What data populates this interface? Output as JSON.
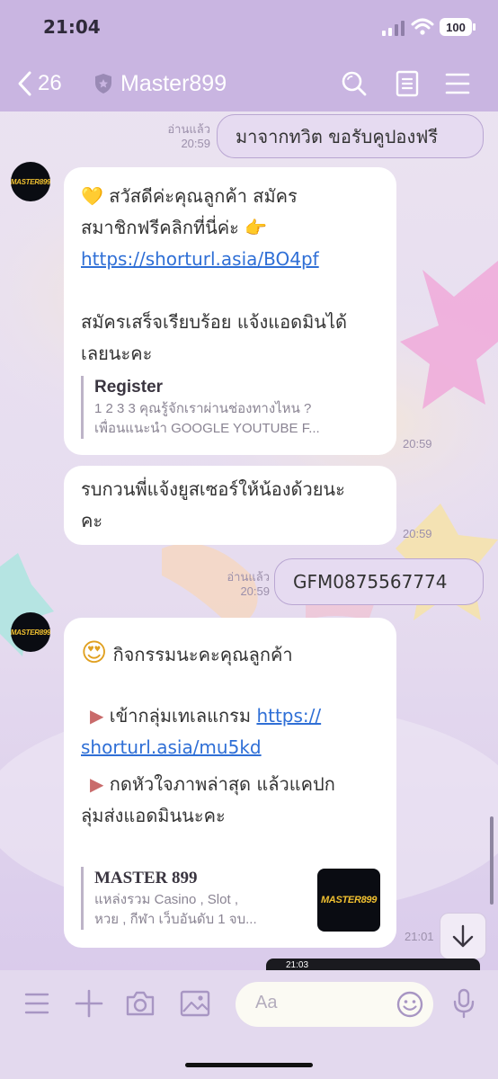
{
  "status": {
    "time": "21:04",
    "battery": "100"
  },
  "header": {
    "back_count": "26",
    "title": "Master899"
  },
  "messages": {
    "m1": {
      "text": "มาจากทวิต ขอรับคูปองฟรี",
      "read": "อ่านแล้ว",
      "time": "20:59"
    },
    "m2": {
      "line1": "สวัสดีค่ะคุณลูกค้า สมัคร",
      "line2": "สมาชิกฟรีคลิกที่นี่ค่ะ",
      "link": "https://shorturl.asia/BO4pf",
      "line3": "สมัครเสร็จเรียบร้อย แจ้งแอดมินได้",
      "line4": "เลยนะคะ",
      "preview_title": "Register",
      "preview_desc1": "1 2 3 3 คุณรู้จักเราผ่านช่องทางไหน ?",
      "preview_desc2": "เพื่อนแนะนำ GOOGLE YOUTUBE F...",
      "time": "20:59"
    },
    "m3": {
      "line1": "รบกวนพี่แจ้งยูสเซอร์ให้น้องด้วยนะ",
      "line2": "คะ",
      "time": "20:59"
    },
    "m4": {
      "text": "GFM0875567774",
      "read": "อ่านแล้ว",
      "time": "20:59"
    },
    "m5": {
      "line1": "กิจกรรมนะคะคุณลูกค้า",
      "line2_text": "เข้ากลุ่มเทเลแกรม",
      "link_a": "https://",
      "link_b": "shorturl.asia/mu5kd",
      "line3": "กดหัวใจภาพล่าสุด แล้วแคปก",
      "line4": "ลุ่มส่งแอดมินนะคะ",
      "preview_title": "MASTER 899",
      "preview_desc1": "แหล่งรวม Casino , Slot ,",
      "preview_desc2": "หวย , กีฬา เว็บอันดับ 1 จบ...",
      "time": "21:01"
    },
    "avatar_text": "MASTER899"
  },
  "mini_screenshot_time": "21:03",
  "input": {
    "placeholder": "Aa"
  },
  "colors": {
    "header": "#c9b5e1",
    "outgoing": "#e6dbf1",
    "link": "#2f6fd6"
  }
}
